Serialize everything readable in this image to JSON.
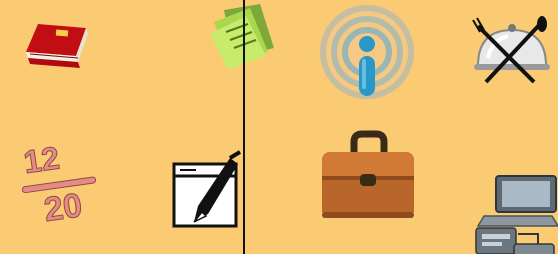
{
  "desktop": {
    "background": "#FBCB73",
    "icons": [
      {
        "name": "address-book-icon",
        "label": "",
        "book_color": "#D4141B"
      },
      {
        "name": "sticky-notes-icon",
        "label": "",
        "note_color": "#B9E15F"
      },
      {
        "name": "info-wifi-icon",
        "label": "",
        "accent": "#2A97C9"
      },
      {
        "name": "dining-cloche-icon",
        "label": ""
      },
      {
        "name": "fraction-icon",
        "label": "",
        "numerator": "12",
        "denominator": "20",
        "color": "#E58A85"
      },
      {
        "name": "pen-editor-icon",
        "label": ""
      },
      {
        "name": "briefcase-icon",
        "label": "",
        "color": "#B8662A"
      },
      {
        "name": "computer-network-icon",
        "label": ""
      }
    ]
  }
}
